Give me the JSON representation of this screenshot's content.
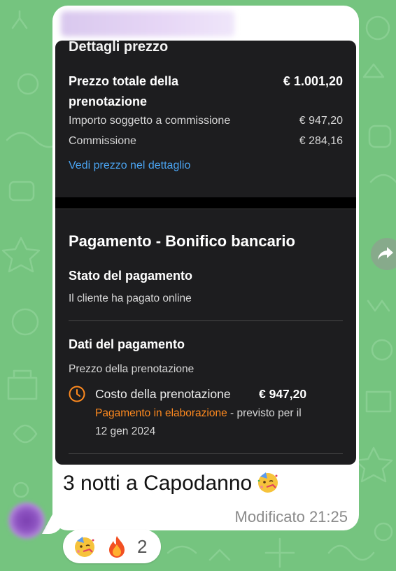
{
  "price_details": {
    "section_title": "Dettagli prezzo",
    "total_label": "Prezzo totale della prenotazione",
    "total_value": "€ 1.001,20",
    "commissionable_label": "Importo soggetto a commissione",
    "commissionable_value": "€ 947,20",
    "commission_label": "Commissione",
    "commission_value": "€ 284,16",
    "detail_link": "Vedi prezzo nel dettaglio"
  },
  "payment": {
    "section_title": "Pagamento - Bonifico bancario",
    "status_title": "Stato del pagamento",
    "status_text": "Il cliente ha pagato online",
    "data_title": "Dati del pagamento",
    "booking_price_label": "Prezzo della prenotazione",
    "cost_label": "Costo della prenotazione",
    "cost_value": "€ 947,20",
    "processing_status": "Pagamento in elaborazione",
    "expected_text": " - previsto per il",
    "expected_date": "12 gen 2024"
  },
  "message": {
    "caption": "3 notti a Capodanno",
    "caption_emoji": "partying-face",
    "edited_label": "Modificato",
    "time": "21:25"
  },
  "reactions": {
    "emojis": [
      "partying-face",
      "fire"
    ],
    "count": "2"
  },
  "colors": {
    "chat_background": "#75c47f",
    "bubble": "#ffffff",
    "dark_panel": "#1d1d1f",
    "link_blue": "#4aa3f0",
    "status_orange": "#ff8a1f"
  }
}
